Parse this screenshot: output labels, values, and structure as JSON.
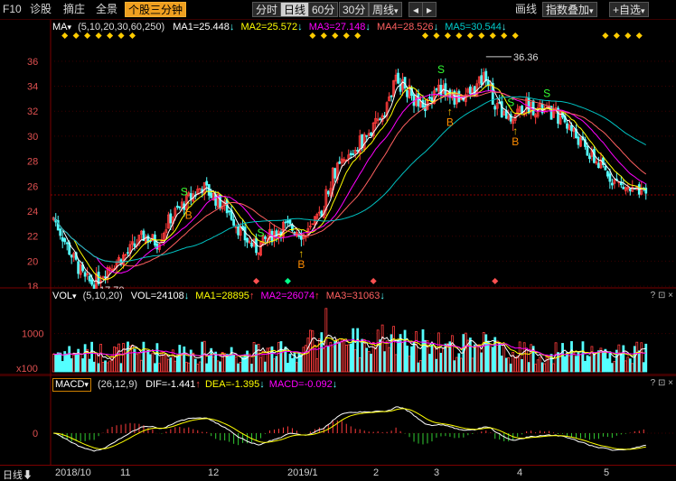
{
  "toolbar": {
    "f10": "F10",
    "diag": "诊股",
    "shares": "摘庄",
    "full": "全景",
    "mode": "个股三分钟",
    "p_fenshi": "分时",
    "p_day": "日线",
    "p_60": "60分",
    "p_30": "30分",
    "p_week": "周线",
    "line_tool": "画线",
    "index_overlay": "指数叠加",
    "add": "+",
    "self_select": "自选",
    "dd": "▾"
  },
  "main": {
    "ind": "MA",
    "ind_dd": "▾",
    "params": "(5,10,20,30,60,250)",
    "ma1": "MA1=25.448",
    "ma2": "MA2=25.572",
    "ma3": "MA3=27.148",
    "ma4": "MA4=28.526",
    "ma5": "MA5=30.544",
    "arr": "↓",
    "arr_up": "↑",
    "high": "36.36",
    "low": "17.70",
    "yticks": [
      "36",
      "34",
      "32",
      "30",
      "28",
      "26",
      "24",
      "22",
      "20",
      "18"
    ],
    "buy": "B",
    "sell": "S",
    "tip": "↑"
  },
  "vol": {
    "ind": "VOL",
    "ind_dd": "▾",
    "params": "(5,10,20)",
    "vol": "VOL=24108",
    "ma1": "MA1=28895",
    "ma2": "MA2=26074",
    "ma3": "MA3=31063",
    "arr_up": "↑",
    "arr": "↓",
    "unit": "x100",
    "tick": "1000"
  },
  "macd": {
    "ind": "MACD",
    "ind_dd": "▾",
    "params": "(26,12,9)",
    "dif": "DIF=-1.441",
    "dea": "DEA=-1.395",
    "macd": "MACD=-0.092",
    "arr_up": "↑",
    "arr": "↓",
    "tick": "0"
  },
  "pane_ctrl": "? ⊡ ×",
  "xaxis": {
    "period": "日线",
    "period_arrow": "⬇",
    "labels": [
      "2018/10",
      "11",
      "12",
      "2019/1",
      "2",
      "3",
      "4",
      "5"
    ]
  },
  "chart_data": {
    "type": "candlestick",
    "period": "daily",
    "x_range": [
      "2018/10",
      "2019/5"
    ],
    "y_range": [
      17.0,
      37.0
    ],
    "high": 36.36,
    "low": 17.7,
    "last": {
      "ma1": 25.448,
      "ma2": 25.572,
      "ma3": 27.148,
      "ma4": 28.526,
      "ma5": 30.544,
      "vol": 24108,
      "vol_ma1": 28895,
      "vol_ma2": 26074,
      "vol_ma3": 31063,
      "dif": -1.441,
      "dea": -1.395,
      "macd": -0.092
    }
  },
  "colors": {
    "up": "#ff3c3c",
    "down": "#54ffff",
    "ma1": "#ffffff",
    "ma2": "#ffff00",
    "ma3": "#ff00ff",
    "ma4": "#ff6060",
    "ma5": "#00c0c0",
    "grid": "#7a0000",
    "mode": "#f0a020"
  }
}
